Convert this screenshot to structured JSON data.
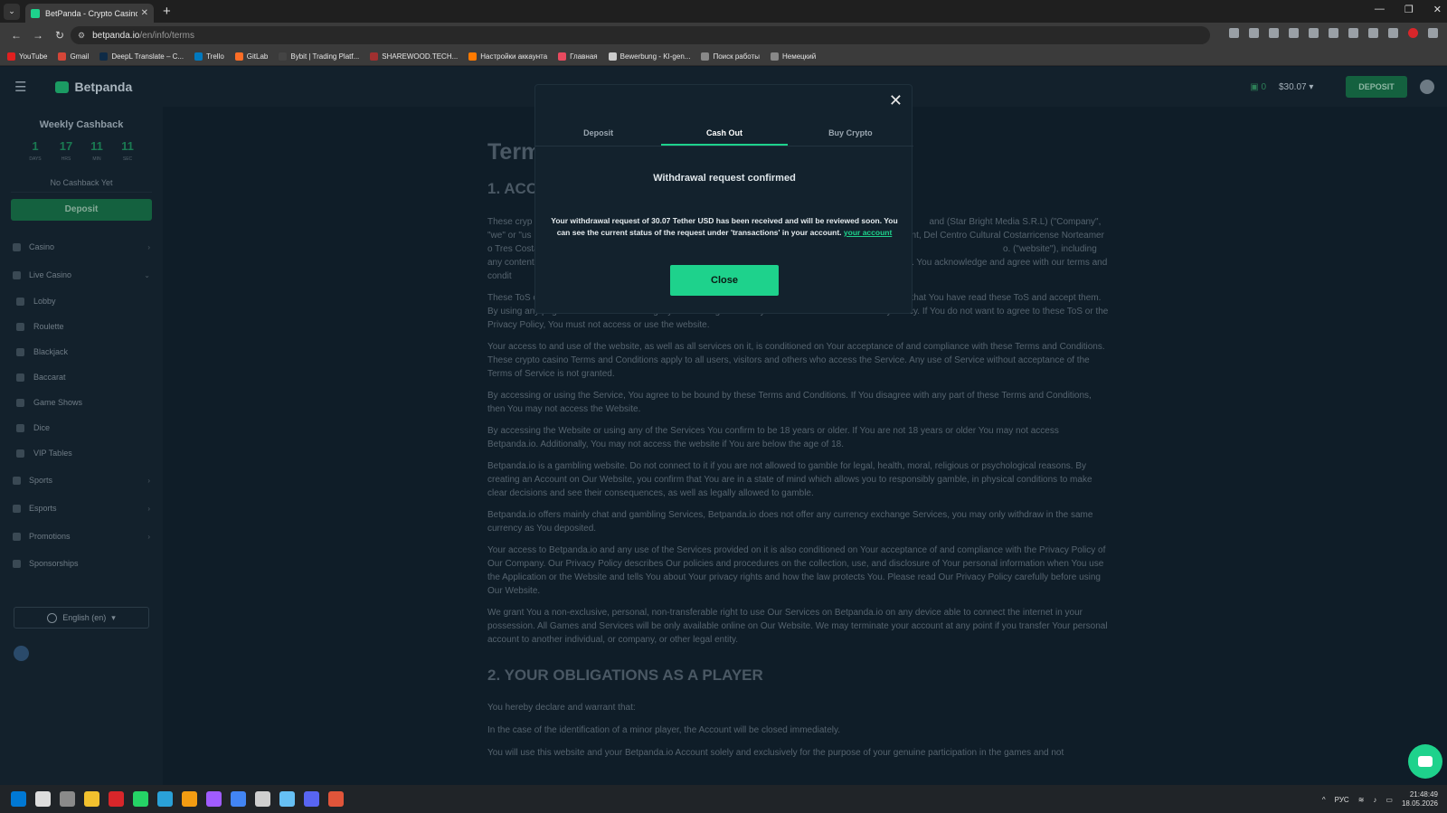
{
  "browser": {
    "tab_title": "BetPanda - Crypto Casino Term",
    "url_domain": "betpanda.io",
    "url_path": "/en/info/terms",
    "bookmarks": [
      {
        "label": "YouTube",
        "color": "#e02020"
      },
      {
        "label": "Gmail",
        "color": "#d44638"
      },
      {
        "label": "DeepL Translate – C...",
        "color": "#0f2b46"
      },
      {
        "label": "Trello",
        "color": "#0079bf"
      },
      {
        "label": "GitLab",
        "color": "#fc6d26"
      },
      {
        "label": "Bybit | Trading Platf...",
        "color": "#444444"
      },
      {
        "label": "SHAREWOOD.TECH...",
        "color": "#a03030"
      },
      {
        "label": "Настройки аккаунта",
        "color": "#ff7a00"
      },
      {
        "label": "Главная",
        "color": "#e84a5f"
      },
      {
        "label": "Bewerbung - KI-gen...",
        "color": "#cccccc"
      },
      {
        "label": "Поиск работы",
        "color": "#888888"
      },
      {
        "label": "Немецкий",
        "color": "#888888"
      }
    ]
  },
  "header": {
    "logo": "Betpanda",
    "coins": "0",
    "balance": "$30.07",
    "deposit_label": "DEPOSIT"
  },
  "sidebar": {
    "cashback_title": "Weekly Cashback",
    "timer": [
      {
        "value": "1",
        "unit": "DAYS"
      },
      {
        "value": "17",
        "unit": "HRS"
      },
      {
        "value": "11",
        "unit": "MIN"
      },
      {
        "value": "11",
        "unit": "SEC"
      }
    ],
    "no_cashback": "No Cashback Yet",
    "deposit_label": "Deposit",
    "items": [
      {
        "label": "Casino",
        "chevron": "›"
      },
      {
        "label": "Live Casino",
        "chevron": "⌄"
      },
      {
        "label": "Lobby",
        "chevron": ""
      },
      {
        "label": "Roulette",
        "chevron": ""
      },
      {
        "label": "Blackjack",
        "chevron": ""
      },
      {
        "label": "Baccarat",
        "chevron": ""
      },
      {
        "label": "Game Shows",
        "chevron": ""
      },
      {
        "label": "Dice",
        "chevron": ""
      },
      {
        "label": "VIP Tables",
        "chevron": ""
      },
      {
        "label": "Sports",
        "chevron": "›"
      },
      {
        "label": "Esports",
        "chevron": "›"
      },
      {
        "label": "Promotions",
        "chevron": "›"
      },
      {
        "label": "Sponsorships",
        "chevron": ""
      }
    ],
    "language": "English (en)"
  },
  "content": {
    "h1": "Term",
    "section1": "1. ACC",
    "p1": "These cryp                                                                                                                                                              and (Star Bright Media S.R.L) (\"Company\", \"we\" or \"us                                                                                                                                        Barrio Dent, Del Centro Cultural Costarricense Norteamer                                                                                                                          o Tres Costa Rica. The following terms of service, (c                                                                                                                          o. (\"website\"), including any content, functionali                                                                                                                                 er. You acknowledge and agree with our terms and condit",
    "p2": "These ToS come into force as soon as You access the website, by doing which you signify to Betpanda.io that You have read these ToS and accept them. By using any page of the Websites You signify that You agree entirely with these ToS and our Privacy Policy. If You do not want to agree to these ToS or the Privacy Policy, You must not access or use the website.",
    "p3": "Your access to and use of the website, as well as all services on it, is conditioned on Your acceptance of and compliance with these Terms and Conditions. These crypto casino Terms and Conditions apply to all users, visitors and others who access the Service. Any use of Service without acceptance of the Terms of Service is not granted.",
    "p4": "By accessing or using the Service, You agree to be bound by these Terms and Conditions. If You disagree with any part of these Terms and Conditions, then You may not access the Website.",
    "p5": "By accessing the Website or using any of the Services You confirm to be 18 years or older. If You are not 18 years or older You may not access Betpanda.io. Additionally, You may not access the website if You are below the age of 18.",
    "p6": "Betpanda.io is a gambling website. Do not connect to it if you are not allowed to gamble for legal, health, moral, religious or psychological reasons. By creating an Account on Our Website, you confirm that You are in a state of mind which allows you to responsibly gamble, in physical conditions to make clear decisions and see their consequences, as well as legally allowed to gamble.",
    "p7": "Betpanda.io offers mainly chat and gambling Services, Betpanda.io does not offer any currency exchange Services, you may only withdraw in the same currency as You deposited.",
    "p8": "Your access to Betpanda.io and any use of the Services provided on it is also conditioned on Your acceptance of and compliance with the Privacy Policy of Our Company. Our Privacy Policy describes Our policies and procedures on the collection, use, and disclosure of Your personal information when You use the Application or the Website and tells You about Your privacy rights and how the law protects You. Please read Our Privacy Policy carefully before using Our Website.",
    "p9": "We grant You a non-exclusive, personal, non-transferable right to use Our Services on Betpanda.io on any device able to connect the internet in your possession. All Games and Services will be only available online on Our Website. We may terminate your account at any point if you transfer Your personal account to another individual, or company, or other legal entity.",
    "section2": "2. YOUR OBLIGATIONS AS A PLAYER",
    "p10": "You hereby declare and warrant that:",
    "p11": "In the case of the identification of a minor player, the Account will be closed immediately.",
    "p12": "You will use this website and your Betpanda.io Account solely and exclusively for the purpose of your genuine participation in the games and not"
  },
  "modal": {
    "tabs": [
      "Deposit",
      "Cash Out",
      "Buy Crypto"
    ],
    "active_tab": "Cash Out",
    "title": "Withdrawal request confirmed",
    "message": "Your withdrawal request of 30.07 Tether USD has been received and will be reviewed soon. You can see the current status of the request under 'transactions' in your account.",
    "link": "your account",
    "close_label": "Close"
  },
  "taskbar": {
    "lang": "РУС",
    "time": "21:48:49",
    "date": "18.05.2026",
    "apps": [
      "#0078d4",
      "#dddddd",
      "#8a8a8a",
      "#f2c12e",
      "#d8262a",
      "#25d366",
      "#2aa1d8",
      "#f39c12",
      "#a05cff",
      "#4285f4",
      "#cfcfcf",
      "#66c0f4",
      "#5865f2",
      "#e0553a"
    ]
  },
  "colors": {
    "accent": "#1ed28c",
    "background": "#0f1d28",
    "sidebar": "#13212c"
  }
}
